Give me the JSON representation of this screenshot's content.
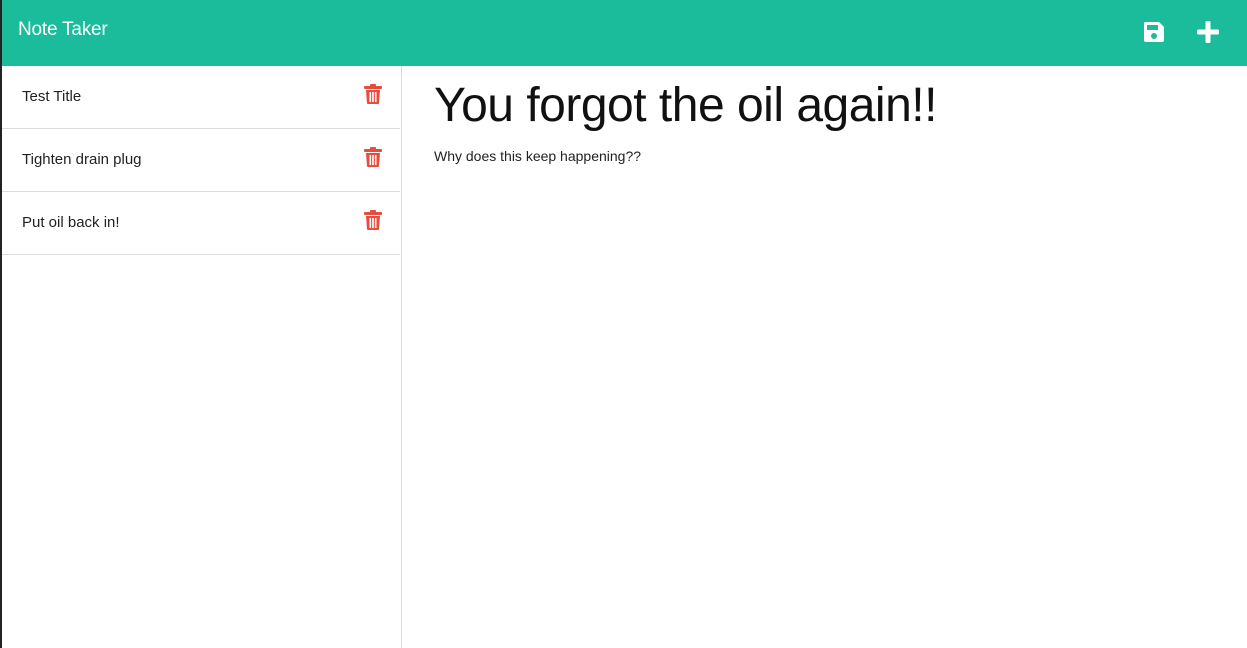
{
  "navbar": {
    "brand": "Note Taker",
    "color": "#1abc9c",
    "save_icon": "floppy-disk-icon",
    "new_icon": "plus-icon"
  },
  "sidebar": {
    "delete_icon": "trash-icon",
    "delete_color": "#e74c3c",
    "notes": [
      {
        "title": "Test Title"
      },
      {
        "title": "Tighten drain plug"
      },
      {
        "title": "Put oil back in!"
      }
    ]
  },
  "editor": {
    "title": "You forgot the oil again!!",
    "body": "Why does this keep happening??"
  }
}
